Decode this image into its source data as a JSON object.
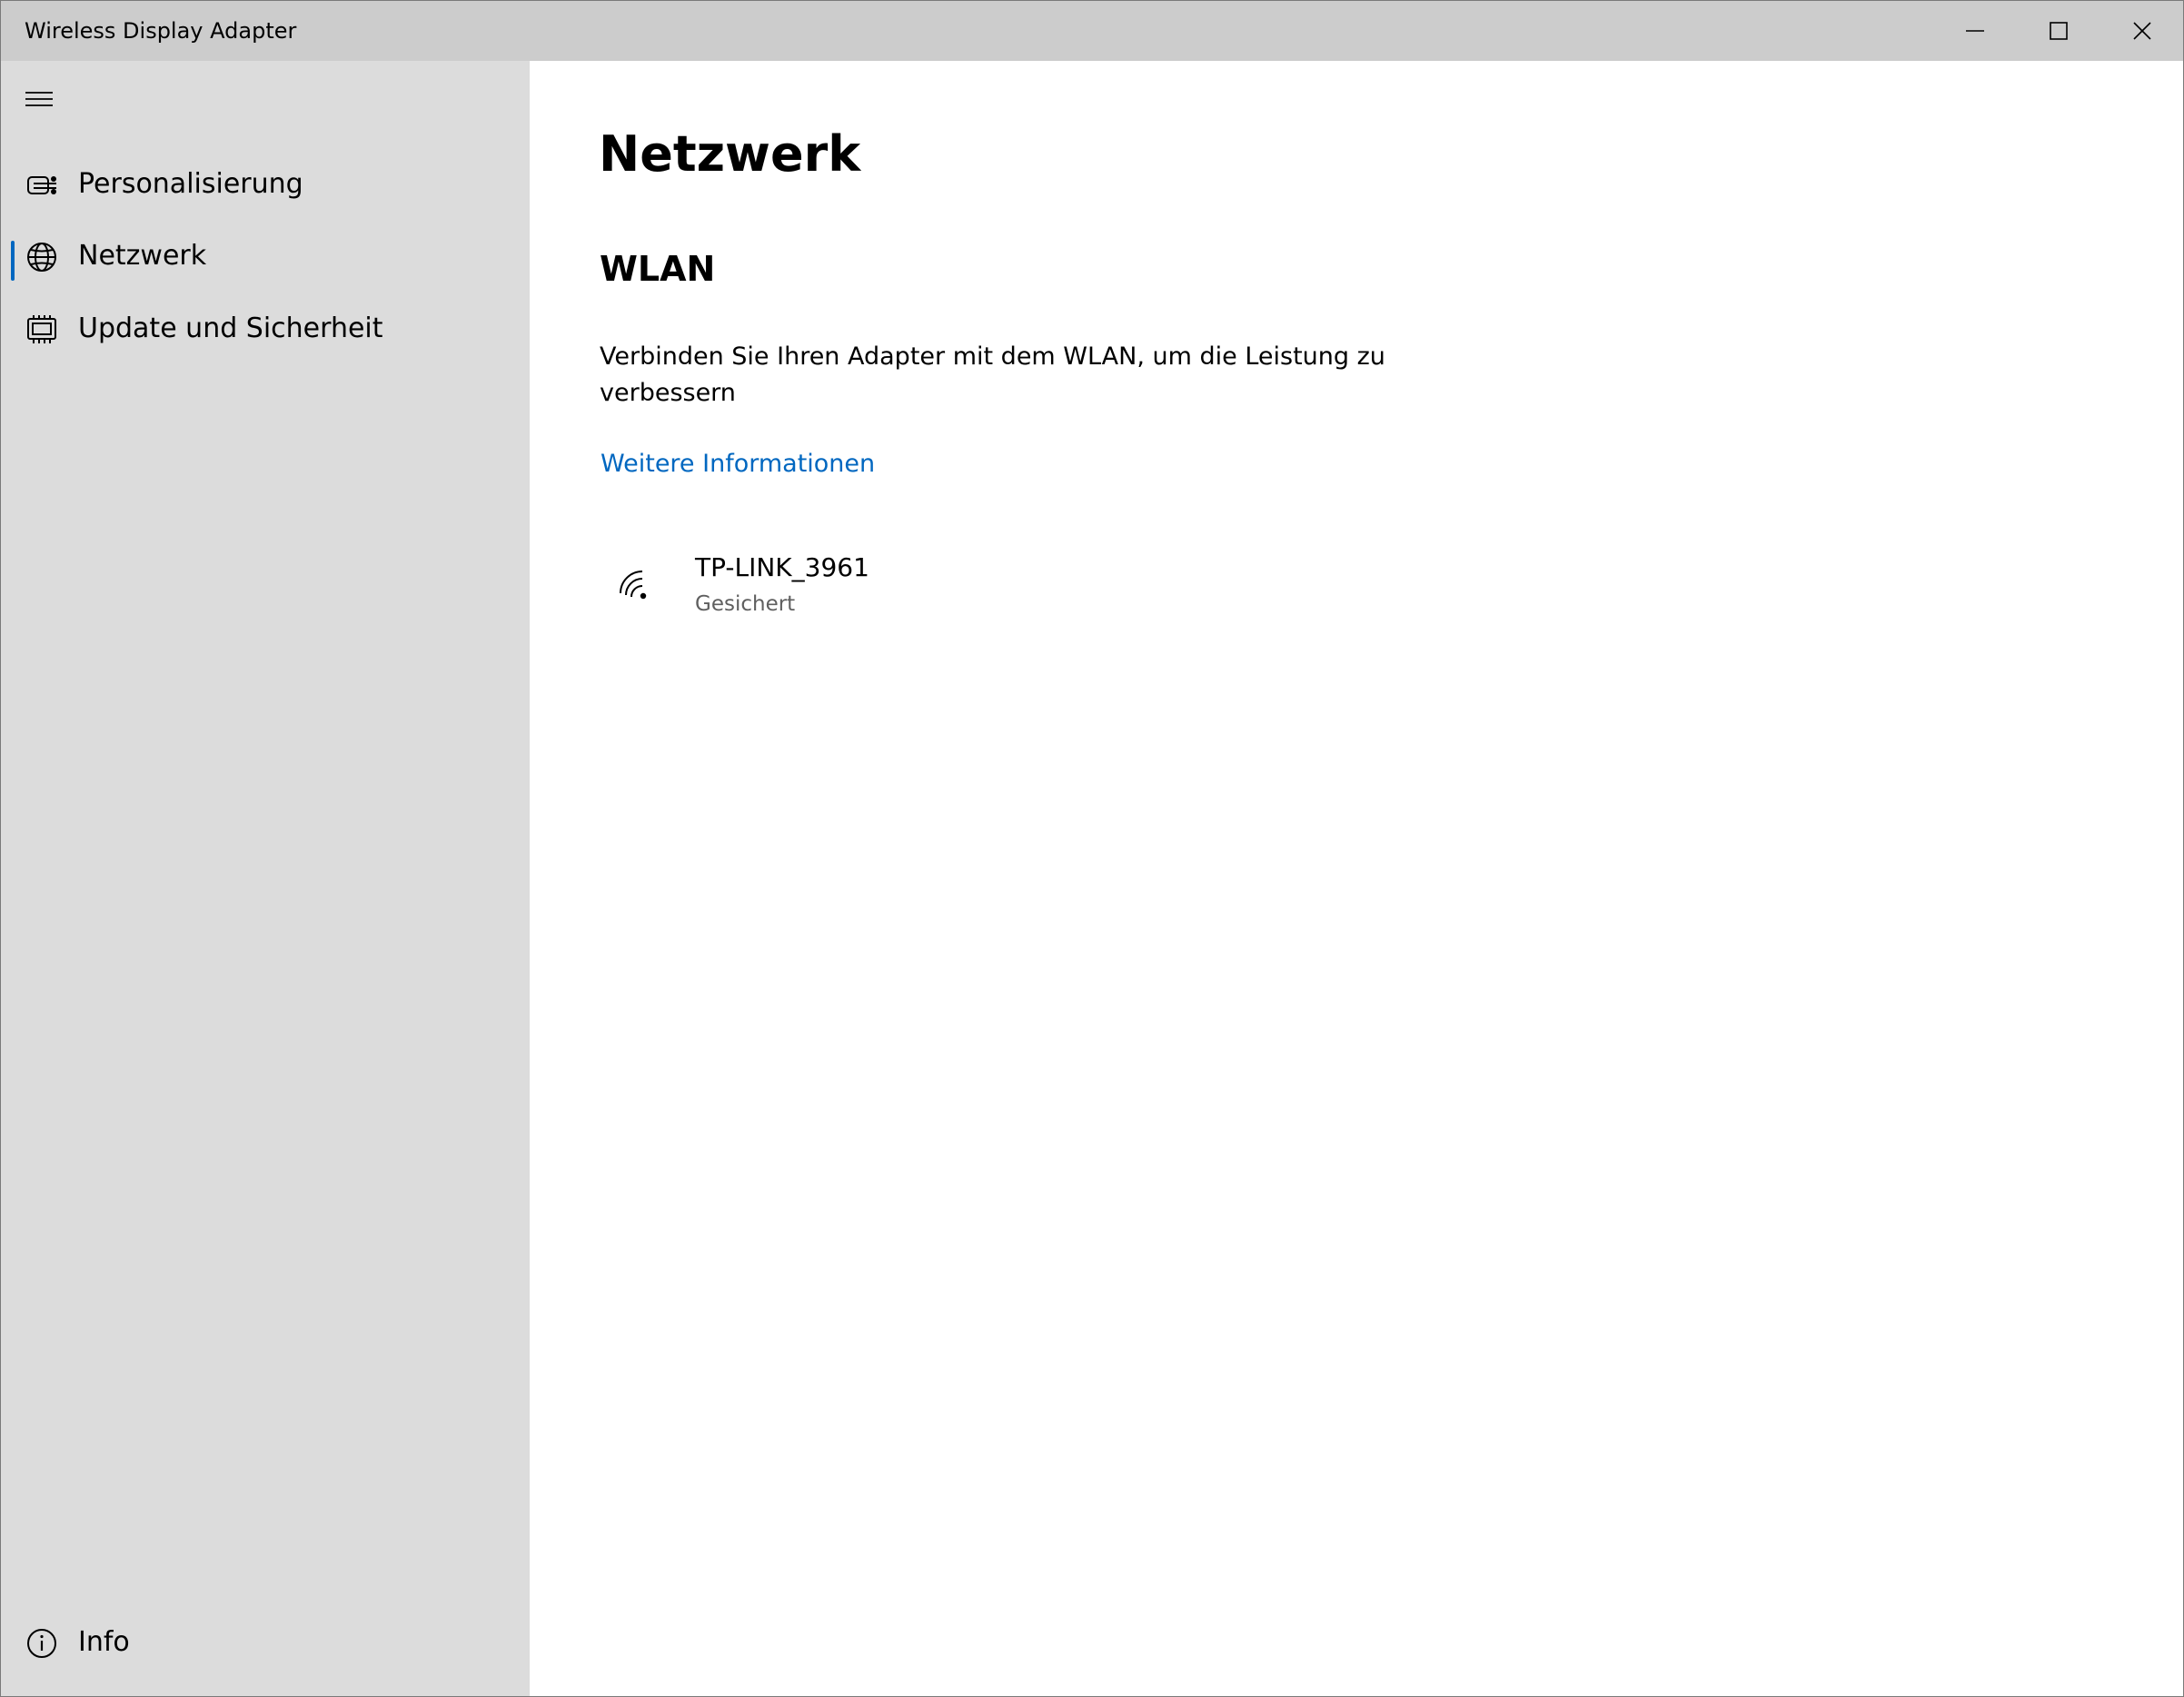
{
  "window": {
    "title": "Wireless Display Adapter",
    "caption_buttons": {
      "minimize_icon": "minimize-icon",
      "maximize_icon": "maximize-icon",
      "close_icon": "close-icon"
    }
  },
  "sidebar": {
    "menu_icon": "hamburger-icon",
    "items": [
      {
        "label": "Personalisierung",
        "icon": "personalization-icon",
        "selected": false
      },
      {
        "label": "Netzwerk",
        "icon": "globe-icon",
        "selected": true
      },
      {
        "label": "Update und Sicherheit",
        "icon": "chip-icon",
        "selected": false
      }
    ],
    "footer": {
      "label": "Info",
      "icon": "info-icon"
    }
  },
  "main": {
    "page_title": "Netzwerk",
    "section_title": "WLAN",
    "description": "Verbinden Sie Ihren Adapter mit dem WLAN, um die Leistung zu verbessern",
    "link": "Weitere Informationen",
    "networks": [
      {
        "name": "TP-LINK_3961",
        "status": "Gesichert",
        "icon": "wifi-secured-icon"
      }
    ]
  },
  "colors": {
    "titlebar": "#cccccc",
    "sidebar": "#dcdcdc",
    "accent": "#0067c0",
    "secondary_text": "#5f5f5f"
  }
}
